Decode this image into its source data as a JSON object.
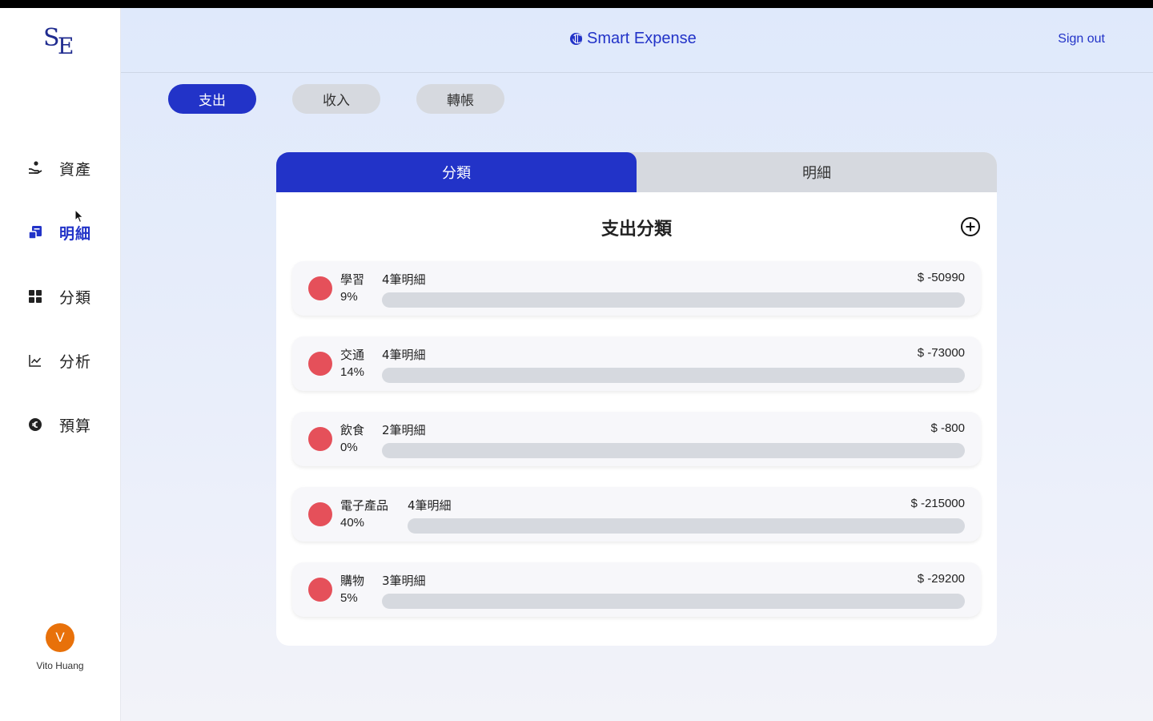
{
  "sidebar": {
    "logo_text": "SE",
    "items": [
      {
        "label": "資產",
        "icon": "hand-coin-icon",
        "active": false
      },
      {
        "label": "明細",
        "icon": "receipt-icon",
        "active": true
      },
      {
        "label": "分類",
        "icon": "grid-icon",
        "active": false
      },
      {
        "label": "分析",
        "icon": "chart-line-icon",
        "active": false
      },
      {
        "label": "預算",
        "icon": "euro-coin-icon",
        "active": false
      }
    ],
    "user": {
      "initial": "V",
      "name": "Vito Huang",
      "avatar_color": "#e8710a"
    }
  },
  "header": {
    "brand": "Smart Expense",
    "signout": "Sign out"
  },
  "type_tabs": [
    {
      "label": "支出",
      "active": true
    },
    {
      "label": "收入",
      "active": false
    },
    {
      "label": "轉帳",
      "active": false
    }
  ],
  "view_tabs": [
    {
      "label": "分類",
      "active": true
    },
    {
      "label": "明細",
      "active": false
    }
  ],
  "card": {
    "title": "支出分類",
    "categories": [
      {
        "name": "學習",
        "percent": "9%",
        "count": "4筆明細",
        "amount": "$ -50990",
        "fill": 0
      },
      {
        "name": "交通",
        "percent": "14%",
        "count": "4筆明細",
        "amount": "$ -73000",
        "fill": 0
      },
      {
        "name": "飲食",
        "percent": "0%",
        "count": "2筆明細",
        "amount": "$ -800",
        "fill": 0
      },
      {
        "name": "電子產品",
        "percent": "40%",
        "count": "4筆明細",
        "amount": "$ -215000",
        "fill": 0
      },
      {
        "name": "購物",
        "percent": "5%",
        "count": "3筆明細",
        "amount": "$ -29200",
        "fill": 0
      }
    ]
  },
  "colors": {
    "accent": "#2233c8",
    "category_dot": "#e5505a",
    "bar_track": "#d6d9df"
  }
}
